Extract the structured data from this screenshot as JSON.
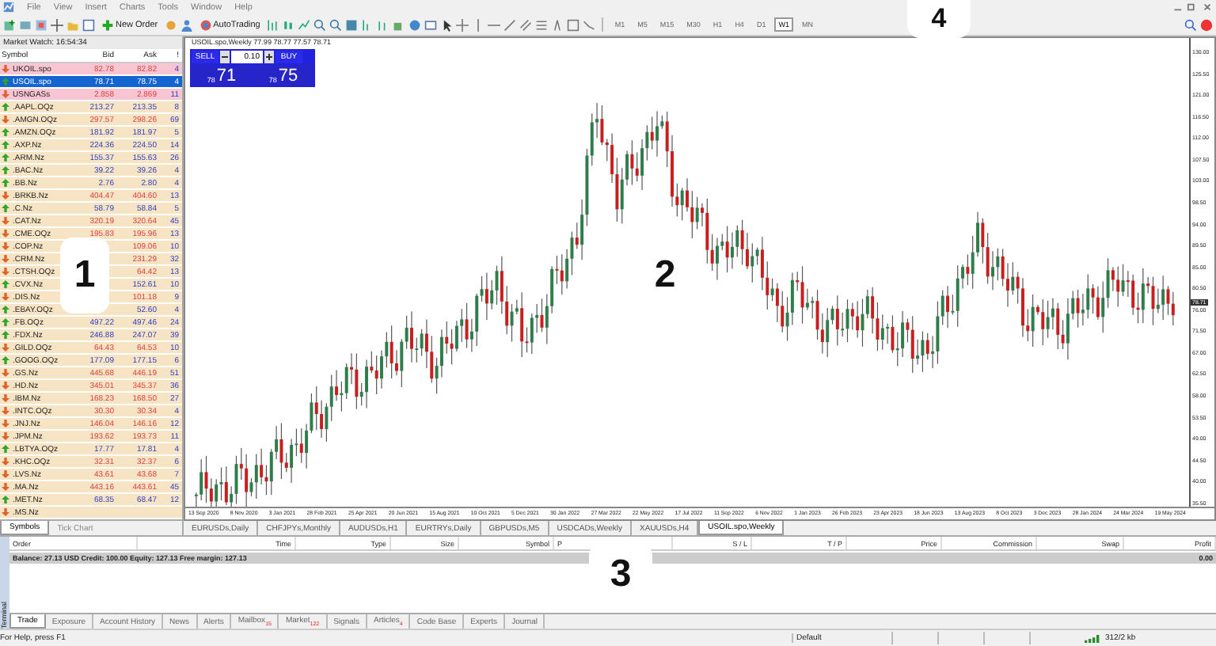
{
  "menu": [
    "File",
    "View",
    "Insert",
    "Charts",
    "Tools",
    "Window",
    "Help"
  ],
  "toolbar": {
    "new_order": "New Order",
    "autotrading": "AutoTrading",
    "timeframes": [
      {
        "label": "M1",
        "selected": false
      },
      {
        "label": "M5",
        "selected": false
      },
      {
        "label": "M15",
        "selected": false
      },
      {
        "label": "M30",
        "selected": false
      },
      {
        "label": "H1",
        "selected": false
      },
      {
        "label": "H4",
        "selected": false
      },
      {
        "label": "D1",
        "selected": false
      },
      {
        "label": "W1",
        "selected": true
      },
      {
        "label": "MN",
        "selected": false
      }
    ]
  },
  "market_watch": {
    "title": "Market Watch: 16:54:34",
    "columns": [
      "Symbol",
      "Bid",
      "Ask",
      "!"
    ],
    "rows": [
      {
        "symbol": "UKOIL.spo",
        "bid": "82.78",
        "ask": "82.82",
        "spread": "4",
        "rising": false,
        "highlighted": true,
        "selected": false
      },
      {
        "symbol": "USOIL.spo",
        "bid": "78.71",
        "ask": "78.75",
        "spread": "4",
        "rising": true,
        "highlighted": false,
        "selected": true
      },
      {
        "symbol": "USNGASs",
        "bid": "2.858",
        "ask": "2.869",
        "spread": "11",
        "rising": false,
        "highlighted": true,
        "selected": false
      },
      {
        "symbol": ".AAPL.OQz",
        "bid": "213.27",
        "ask": "213.35",
        "spread": "8",
        "rising": true,
        "highlighted": false,
        "selected": false
      },
      {
        "symbol": ".AMGN.OQz",
        "bid": "297.57",
        "ask": "298.26",
        "spread": "69",
        "rising": false,
        "highlighted": false,
        "selected": false
      },
      {
        "symbol": ".AMZN.OQz",
        "bid": "181.92",
        "ask": "181.97",
        "spread": "5",
        "rising": true,
        "highlighted": false,
        "selected": false
      },
      {
        "symbol": ".AXP.Nz",
        "bid": "224.36",
        "ask": "224.50",
        "spread": "14",
        "rising": true,
        "highlighted": false,
        "selected": false
      },
      {
        "symbol": ".ARM.Nz",
        "bid": "155.37",
        "ask": "155.63",
        "spread": "26",
        "rising": true,
        "highlighted": false,
        "selected": false
      },
      {
        "symbol": ".BAC.Nz",
        "bid": "39.22",
        "ask": "39.26",
        "spread": "4",
        "rising": true,
        "highlighted": false,
        "selected": false
      },
      {
        "symbol": ".BB.Nz",
        "bid": "2.76",
        "ask": "2.80",
        "spread": "4",
        "rising": true,
        "highlighted": false,
        "selected": false
      },
      {
        "symbol": ".BRKB.Nz",
        "bid": "404.47",
        "ask": "404.60",
        "spread": "13",
        "rising": false,
        "highlighted": false,
        "selected": false
      },
      {
        "symbol": ".C.Nz",
        "bid": "58.79",
        "ask": "58.84",
        "spread": "5",
        "rising": true,
        "highlighted": false,
        "selected": false
      },
      {
        "symbol": ".CAT.Nz",
        "bid": "320.19",
        "ask": "320.64",
        "spread": "45",
        "rising": false,
        "highlighted": false,
        "selected": false
      },
      {
        "symbol": ".CME.OQz",
        "bid": "195.83",
        "ask": "195.96",
        "spread": "13",
        "rising": false,
        "highlighted": false,
        "selected": false
      },
      {
        "symbol": ".COP.Nz",
        "ask": "109.06",
        "spread": "10",
        "rising": false,
        "highlighted": false,
        "selected": false
      },
      {
        "symbol": ".CRM.Nz",
        "ask": "231.29",
        "spread": "32",
        "rising": false,
        "highlighted": false,
        "selected": false
      },
      {
        "symbol": ".CTSH.OQz",
        "ask": "64.42",
        "spread": "13",
        "rising": false,
        "highlighted": false,
        "selected": false
      },
      {
        "symbol": ".CVX.Nz",
        "ask": "152.61",
        "spread": "10",
        "rising": true,
        "highlighted": false,
        "selected": false
      },
      {
        "symbol": ".DIS.Nz",
        "ask": "101.18",
        "spread": "9",
        "rising": false,
        "highlighted": false,
        "selected": false
      },
      {
        "symbol": ".EBAY.OQz",
        "ask": "52.60",
        "spread": "4",
        "rising": true,
        "highlighted": false,
        "selected": false
      },
      {
        "symbol": ".FB.OQz",
        "bid": "497.22",
        "ask": "497.46",
        "spread": "24",
        "rising": true,
        "highlighted": false,
        "selected": false
      },
      {
        "symbol": ".FDX.Nz",
        "bid": "246.88",
        "ask": "247.07",
        "spread": "39",
        "rising": true,
        "highlighted": false,
        "selected": false
      },
      {
        "symbol": ".GILD.OQz",
        "bid": "64.43",
        "ask": "64.53",
        "spread": "10",
        "rising": false,
        "highlighted": false,
        "selected": false
      },
      {
        "symbol": ".GOOG.OQz",
        "bid": "177.09",
        "ask": "177.15",
        "spread": "6",
        "rising": true,
        "highlighted": false,
        "selected": false
      },
      {
        "symbol": ".GS.Nz",
        "bid": "445.68",
        "ask": "446.19",
        "spread": "51",
        "rising": false,
        "highlighted": false,
        "selected": false
      },
      {
        "symbol": ".HD.Nz",
        "bid": "345.01",
        "ask": "345.37",
        "spread": "36",
        "rising": false,
        "highlighted": false,
        "selected": false
      },
      {
        "symbol": ".IBM.Nz",
        "bid": "168.23",
        "ask": "168.50",
        "spread": "27",
        "rising": false,
        "highlighted": false,
        "selected": false
      },
      {
        "symbol": ".INTC.OQz",
        "bid": "30.30",
        "ask": "30.34",
        "spread": "4",
        "rising": false,
        "highlighted": false,
        "selected": false
      },
      {
        "symbol": ".JNJ.Nz",
        "bid": "146.04",
        "ask": "146.16",
        "spread": "12",
        "rising": false,
        "highlighted": false,
        "selected": false
      },
      {
        "symbol": ".JPM.Nz",
        "bid": "193.62",
        "ask": "193.73",
        "spread": "11",
        "rising": false,
        "highlighted": false,
        "selected": false
      },
      {
        "symbol": ".LBTYA.OQz",
        "bid": "17.77",
        "ask": "17.81",
        "spread": "4",
        "rising": true,
        "highlighted": false,
        "selected": false
      },
      {
        "symbol": ".KHC.OQz",
        "bid": "32.31",
        "ask": "32.37",
        "spread": "6",
        "rising": false,
        "highlighted": false,
        "selected": false
      },
      {
        "symbol": ".LVS.Nz",
        "bid": "43.61",
        "ask": "43.68",
        "spread": "7",
        "rising": false,
        "highlighted": false,
        "selected": false
      },
      {
        "symbol": ".MA.Nz",
        "bid": "443.16",
        "ask": "443.61",
        "spread": "45",
        "rising": false,
        "highlighted": false,
        "selected": false
      },
      {
        "symbol": ".MET.Nz",
        "bid": "68.35",
        "ask": "68.47",
        "spread": "12",
        "rising": true,
        "highlighted": false,
        "selected": false
      },
      {
        "symbol": ".MS.Nz",
        "rising": false,
        "highlighted": false,
        "selected": false
      }
    ],
    "tabs": [
      {
        "label": "Symbols",
        "selected": true
      },
      {
        "label": "Tick Chart",
        "selected": false
      }
    ]
  },
  "chart": {
    "title": "USOIL.spo,Weekly  77.99 78.77 77.57 78.71",
    "one_click": {
      "sell": "SELL",
      "lot": "0.10",
      "buy": "BUY",
      "sell_small": "78",
      "sell_big": "71",
      "buy_small": "78",
      "buy_big": "75"
    },
    "price_axis": [
      "130.00",
      "125.50",
      "121.00",
      "116.50",
      "112.00",
      "107.50",
      "103.00",
      "98.50",
      "94.00",
      "89.50",
      "85.00",
      "80.50",
      "76.00",
      "71.50",
      "67.00",
      "62.50",
      "58.00",
      "53.50",
      "49.00",
      "44.50",
      "40.00",
      "35.50"
    ],
    "current_price": "78.71",
    "time_axis": [
      "13 Sep 2020",
      "8 Nov 2020",
      "3 Jan 2021",
      "28 Feb 2021",
      "25 Apr 2021",
      "20 Jun 2021",
      "15 Aug 2021",
      "10 Oct 2021",
      "5 Dec 2021",
      "30 Jan 2022",
      "27 Mar 2022",
      "22 May 2022",
      "17 Jul 2022",
      "11 Sep 2022",
      "6 Nov 2022",
      "1 Jan 2023",
      "26 Feb 2023",
      "23 Apr 2023",
      "18 Jun 2023",
      "13 Aug 2023",
      "8 Oct 2023",
      "3 Dec 2023",
      "28 Jan 2024",
      "24 Mar 2024",
      "19 May 2024"
    ],
    "tabs": [
      {
        "label": "EURUSDs,Daily",
        "selected": false
      },
      {
        "label": "CHFJPYs,Monthly",
        "selected": false
      },
      {
        "label": "AUDUSDs,H1",
        "selected": false
      },
      {
        "label": "EURTRYs,Daily",
        "selected": false
      },
      {
        "label": "GBPUSDs,M5",
        "selected": false
      },
      {
        "label": "USDCADs,Weekly",
        "selected": false
      },
      {
        "label": "XAUUSDs,H4",
        "selected": false
      },
      {
        "label": "USOIL.spo,Weekly",
        "selected": true
      }
    ]
  },
  "terminal": {
    "side_label": "Terminal",
    "columns": [
      "Order",
      "Time",
      "Type",
      "Size",
      "Symbol",
      "P",
      "S / L",
      "T / P",
      "Price",
      "Commission",
      "Swap",
      "Profit"
    ],
    "balance": "Balance: 27.13 USD  Credit: 100.00  Equity: 127.13  Free margin: 127.13",
    "profit": "0.00",
    "tabs": [
      {
        "label": "Trade",
        "selected": true
      },
      {
        "label": "Exposure",
        "selected": false
      },
      {
        "label": "Account History",
        "selected": false
      },
      {
        "label": "News",
        "selected": false
      },
      {
        "label": "Alerts",
        "selected": false
      },
      {
        "label": "Mailbox",
        "badge": "15",
        "selected": false
      },
      {
        "label": "Market",
        "badge": "122",
        "selected": false
      },
      {
        "label": "Signals",
        "selected": false
      },
      {
        "label": "Articles",
        "badge": "4",
        "selected": false
      },
      {
        "label": "Code Base",
        "selected": false
      },
      {
        "label": "Experts",
        "selected": false
      },
      {
        "label": "Journal",
        "selected": false
      }
    ]
  },
  "status_bar": {
    "help": "For Help, press F1",
    "profile": "Default",
    "traffic": "312/2 kb"
  },
  "callouts": [
    "1",
    "2",
    "3",
    "4"
  ]
}
